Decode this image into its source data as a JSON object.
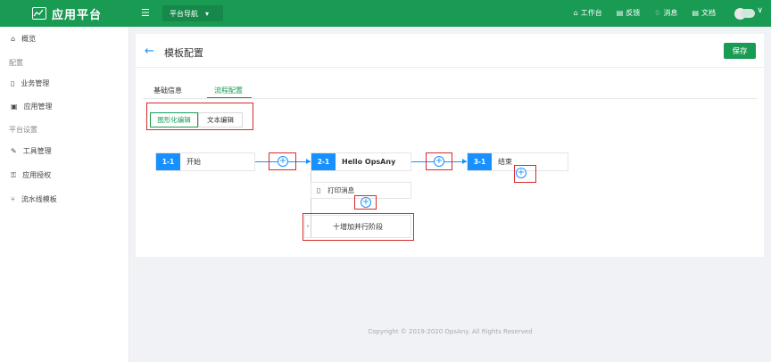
{
  "header": {
    "app_title": "应用平台",
    "menu_glyph": "☰",
    "nav_select": "平台导航",
    "nav_caret": "▾",
    "links": [
      {
        "icon": "home-icon",
        "glyph": "⌂",
        "label": "工作台"
      },
      {
        "icon": "feedback-icon",
        "glyph": "▤",
        "label": "反馈"
      },
      {
        "icon": "bell-icon",
        "glyph": "♢",
        "label": "消息"
      },
      {
        "icon": "doc-icon",
        "glyph": "▤",
        "label": "文档"
      }
    ],
    "user_caret": "∨"
  },
  "sidebar": {
    "items": [
      {
        "icon": "home-icon",
        "glyph": "⌂",
        "label": "概览"
      },
      {
        "group": "配置"
      },
      {
        "icon": "file-icon",
        "glyph": "▯",
        "label": "业务管理"
      },
      {
        "icon": "app-icon",
        "glyph": "▣",
        "label": "应用管理"
      },
      {
        "group": "平台设置"
      },
      {
        "icon": "tool-icon",
        "glyph": "✎",
        "label": "工具管理"
      },
      {
        "icon": "lock-icon",
        "glyph": "⚿",
        "label": "应用授权"
      },
      {
        "icon": "pipeline-icon",
        "glyph": "⑂",
        "label": "流水线模板"
      }
    ]
  },
  "page": {
    "back_glyph": "←",
    "title": "模板配置",
    "save_label": "保存",
    "tabs": [
      {
        "label": "基础信息",
        "active": false
      },
      {
        "label": "流程配置",
        "active": true
      }
    ],
    "modes": [
      {
        "label": "图形化编辑",
        "active": true
      },
      {
        "label": "文本编辑",
        "active": false
      }
    ]
  },
  "flow": {
    "stages": [
      {
        "id": "1-1",
        "label": "开始"
      },
      {
        "id": "2-1",
        "label": "Hello OpsAny"
      },
      {
        "id": "3-1",
        "label": "结束"
      }
    ],
    "sub_task": {
      "glyph": "▯",
      "label": "打印消息"
    },
    "plus_glyph": "+",
    "add_parallel_label": "十增加并行阶段",
    "add_parallel_marker": "▸"
  },
  "footer": {
    "copyright": "Copyright © 2019-2020 OpsAny. All Rights Reserved"
  },
  "colors": {
    "brand_green": "#1a9b54",
    "node_blue": "#1890ff",
    "highlight_red": "#d9292a"
  }
}
